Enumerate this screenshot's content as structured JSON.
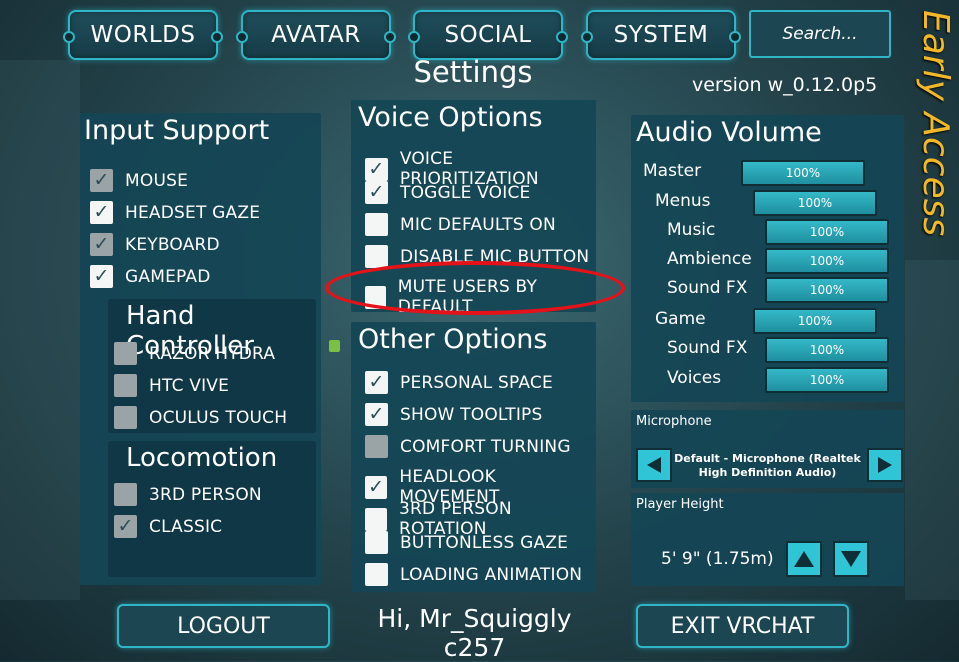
{
  "nav": {
    "worlds": "WORLDS",
    "avatar": "AVATAR",
    "social": "SOCIAL",
    "system": "SYSTEM",
    "search_placeholder": "Search..."
  },
  "header": {
    "title": "Settings",
    "version": "version w_0.12.0p5",
    "badge": "Early Access"
  },
  "input_support": {
    "title": "Input Support",
    "items": [
      {
        "label": "MOUSE",
        "state": "checked-dim"
      },
      {
        "label": "HEADSET GAZE",
        "state": "checked"
      },
      {
        "label": "KEYBOARD",
        "state": "checked-dim"
      },
      {
        "label": "GAMEPAD",
        "state": "checked"
      }
    ],
    "hand_controller": {
      "title": "Hand Controller",
      "items": [
        {
          "label": "RAZOR HYDRA",
          "state": "disabled"
        },
        {
          "label": "HTC VIVE",
          "state": "disabled"
        },
        {
          "label": "OCULUS TOUCH",
          "state": "disabled"
        }
      ]
    },
    "locomotion": {
      "title": "Locomotion",
      "items": [
        {
          "label": "3RD PERSON",
          "state": "disabled"
        },
        {
          "label": "CLASSIC",
          "state": "checked-dim"
        }
      ]
    }
  },
  "voice_options": {
    "title": "Voice Options",
    "items": [
      {
        "label": "VOICE PRIORITIZATION",
        "state": "checked"
      },
      {
        "label": "TOGGLE VOICE",
        "state": "checked"
      },
      {
        "label": "MIC DEFAULTS ON",
        "state": "unchecked"
      },
      {
        "label": "DISABLE MIC BUTTON",
        "state": "unchecked"
      },
      {
        "label": "MUTE USERS BY DEFAULT",
        "state": "unchecked"
      }
    ]
  },
  "other_options": {
    "title": "Other Options",
    "items": [
      {
        "label": "PERSONAL SPACE",
        "state": "checked"
      },
      {
        "label": "SHOW TOOLTIPS",
        "state": "checked"
      },
      {
        "label": "COMFORT TURNING",
        "state": "disabled"
      },
      {
        "label": "HEADLOOK MOVEMENT",
        "state": "checked"
      },
      {
        "label": "3RD PERSON ROTATION",
        "state": "unchecked"
      },
      {
        "label": "BUTTONLESS GAZE",
        "state": "unchecked"
      },
      {
        "label": "LOADING ANIMATION",
        "state": "unchecked"
      }
    ]
  },
  "audio_volume": {
    "title": "Audio Volume",
    "rows": [
      {
        "label": "Master",
        "value": "100%",
        "level": 1.0
      },
      {
        "label": "Menus",
        "value": "100%",
        "level": 1.0
      },
      {
        "label": "Music",
        "value": "100%",
        "level": 1.0
      },
      {
        "label": "Ambience",
        "value": "100%",
        "level": 1.0
      },
      {
        "label": "Sound FX",
        "value": "100%",
        "level": 1.0
      },
      {
        "label": "Game",
        "value": "100%",
        "level": 1.0
      },
      {
        "label": "Sound FX",
        "value": "100%",
        "level": 1.0
      },
      {
        "label": "Voices",
        "value": "100%",
        "level": 1.0
      }
    ]
  },
  "microphone": {
    "title": "Microphone",
    "device_line1": "Default - Microphone (Realtek",
    "device_line2": "High Definition Audio)"
  },
  "player_height": {
    "title": "Player Height",
    "value": "5' 9\" (1.75m)"
  },
  "footer": {
    "logout": "LOGOUT",
    "greeting": "Hi, Mr_Squiggly c257",
    "exit": "EXIT VRCHAT"
  },
  "colors": {
    "accent": "#2fb6c6",
    "panel": "#14465a",
    "early_access": "#f3b829",
    "highlight": "#e41219"
  }
}
